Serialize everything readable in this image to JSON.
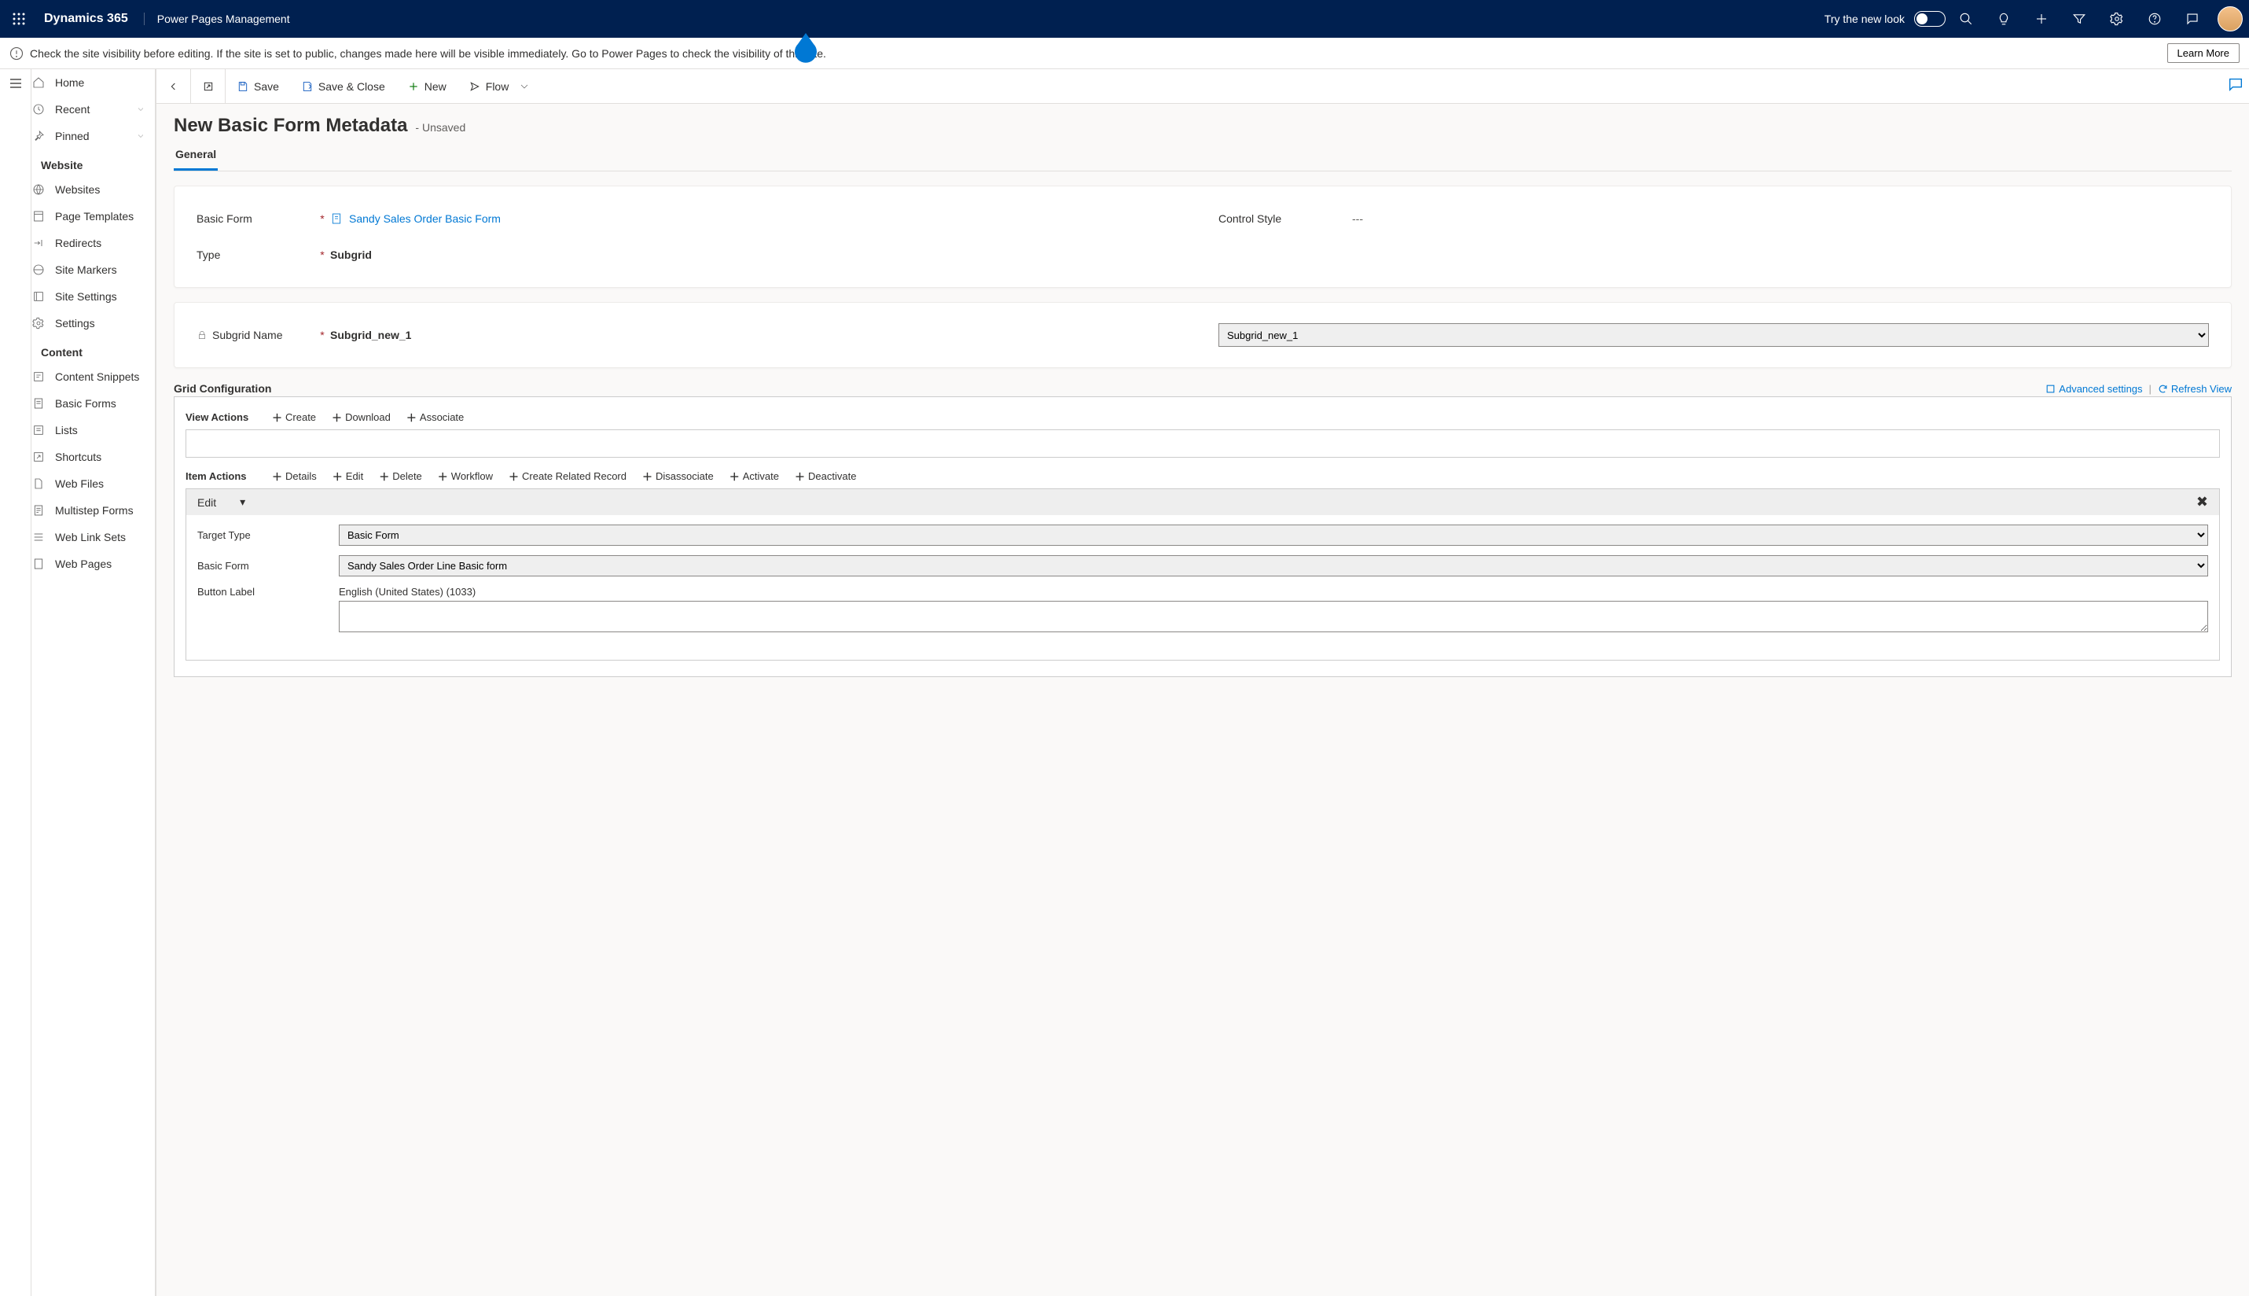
{
  "topbar": {
    "brand": "Dynamics 365",
    "subtitle": "Power Pages Management",
    "try_new_look": "Try the new look"
  },
  "infobar": {
    "message": "Check the site visibility before editing. If the site is set to public, changes made here will be visible immediately. Go to Power Pages to check the visibility of this site.",
    "learn_more": "Learn More"
  },
  "cmdbar": {
    "save": "Save",
    "save_close": "Save & Close",
    "new": "New",
    "flow": "Flow"
  },
  "sidebar": {
    "home": "Home",
    "recent": "Recent",
    "pinned": "Pinned",
    "group_website": "Website",
    "websites": "Websites",
    "page_templates": "Page Templates",
    "redirects": "Redirects",
    "site_markers": "Site Markers",
    "site_settings": "Site Settings",
    "settings": "Settings",
    "group_content": "Content",
    "content_snippets": "Content Snippets",
    "basic_forms": "Basic Forms",
    "lists": "Lists",
    "shortcuts": "Shortcuts",
    "web_files": "Web Files",
    "multistep_forms": "Multistep Forms",
    "web_link_sets": "Web Link Sets",
    "web_pages": "Web Pages"
  },
  "page": {
    "title": "New Basic Form Metadata",
    "unsaved": "- Unsaved",
    "tab_general": "General"
  },
  "fields": {
    "basic_form_label": "Basic Form",
    "basic_form_value": "Sandy Sales Order Basic Form",
    "control_style_label": "Control Style",
    "control_style_value": "---",
    "type_label": "Type",
    "type_value": "Subgrid",
    "subgrid_name_label": "Subgrid Name",
    "subgrid_name_value": "Subgrid_new_1",
    "subgrid_select_value": "Subgrid_new_1"
  },
  "gridconf": {
    "section_title": "Grid Configuration",
    "advanced_settings": "Advanced settings",
    "refresh_view": "Refresh View",
    "view_actions_label": "View Actions",
    "view_actions": {
      "create": "Create",
      "download": "Download",
      "associate": "Associate"
    },
    "item_actions_label": "Item Actions",
    "item_actions": {
      "details": "Details",
      "edit": "Edit",
      "delete": "Delete",
      "workflow": "Workflow",
      "create_related": "Create Related Record",
      "disassociate": "Disassociate",
      "activate": "Activate",
      "deactivate": "Deactivate"
    },
    "edit_header": "Edit",
    "target_type_label": "Target Type",
    "target_type_value": "Basic Form",
    "basic_form_label": "Basic Form",
    "basic_form_value": "Sandy Sales Order Line Basic form",
    "button_label_label": "Button Label",
    "button_label_lang": "English (United States) (1033)"
  }
}
